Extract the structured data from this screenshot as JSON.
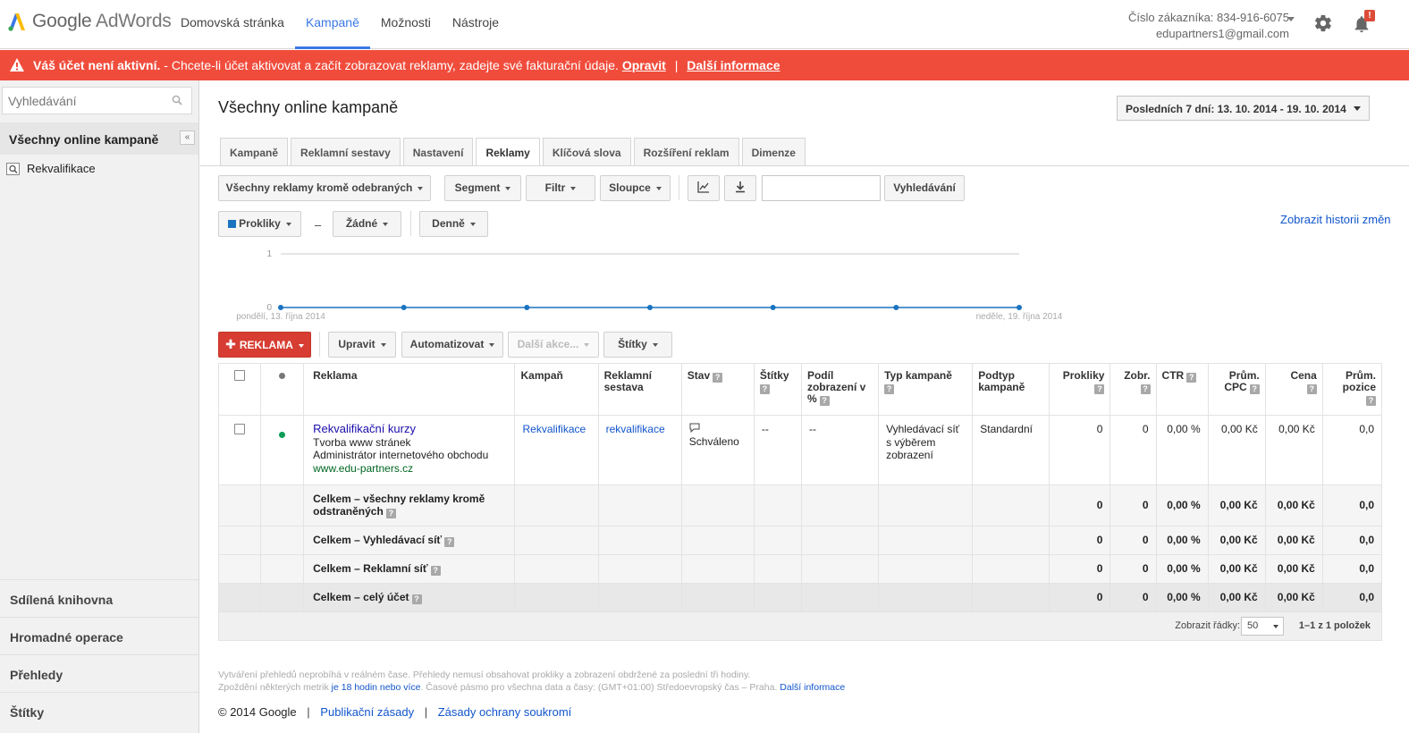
{
  "header": {
    "logo_google": "Google",
    "logo_product": "AdWords",
    "nav": [
      "Domovská stránka",
      "Kampaně",
      "Možnosti",
      "Nástroje"
    ],
    "active_nav": "Kampaně",
    "customer_id_label": "Číslo zákazníka: 834-916-6075",
    "email": "edupartners1@gmail.com",
    "notification_badge": "!"
  },
  "alert": {
    "bold": "Váš účet není aktivní.",
    "text": " - Chcete-li účet aktivovat a začít zobrazovat reklamy, zadejte své fakturační údaje.",
    "link1": "Opravit",
    "sep": "|",
    "link2": "Další informace",
    "color": "#f04c3c"
  },
  "sidebar": {
    "search_placeholder": "Vyhledávání",
    "all_campaigns": "Všechny online kampaně",
    "collapse": "«",
    "campaign": "Rekvalifikace",
    "bottom": [
      "Sdílená knihovna",
      "Hromadné operace",
      "Přehledy",
      "Štítky"
    ]
  },
  "main": {
    "title": "Všechny online kampaně",
    "date_range": "Posledních 7 dní: 13. 10. 2014 - 19. 10. 2014",
    "tabs": [
      "Kampaně",
      "Reklamní sestavy",
      "Nastavení",
      "Reklamy",
      "Klíčová slova",
      "Rozšíření reklam",
      "Dimenze"
    ],
    "active_tab": "Reklamy",
    "toolbar": {
      "filter_all": "Všechny reklamy kromě odebraných",
      "segment": "Segment",
      "filter": "Filtr",
      "columns": "Sloupce",
      "search_button": "Vyhledávání"
    },
    "chart_controls": {
      "metric1": "Prokliky",
      "dash": "–",
      "metric2": "Žádné",
      "period": "Denně",
      "history_link": "Zobrazit historii změn"
    },
    "actions": {
      "add": "REKLAMA",
      "edit": "Upravit",
      "automate": "Automatizovat",
      "more": "Další akce...",
      "labels": "Štítky"
    }
  },
  "chart_data": {
    "type": "line",
    "x": [
      "pondělí, 13. října 2014",
      "",
      "",
      "",
      "",
      "",
      "neděle, 19. října 2014"
    ],
    "series": [
      {
        "values": [
          0,
          0,
          0,
          0,
          0,
          0,
          0
        ]
      }
    ],
    "y_ticks": [
      "1",
      "0"
    ],
    "ylim": [
      0,
      1
    ],
    "grid": true,
    "line_color": "#1a73c0"
  },
  "table": {
    "headers": {
      "ad": "Reklama",
      "campaign": "Kampaň",
      "adgroup_line1": "Reklamní",
      "adgroup_line2": "sestava",
      "status": "Stav",
      "labels": "Štítky",
      "share_line1": "Podíl",
      "share_line2": "zobrazení v",
      "share_line3": "%",
      "camp_type": "Typ kampaně",
      "subtype_line1": "Podtyp",
      "subtype_line2": "kampaně",
      "clicks": "Prokliky",
      "impr": "Zobr.",
      "ctr": "CTR",
      "cpc_line1": "Prům.",
      "cpc_line2": "CPC",
      "cost": "Cena",
      "pos_line1": "Prům.",
      "pos_line2": "pozice",
      "help": "?"
    },
    "row": {
      "ad_title": "Rekvalifikační kurzy",
      "ad_line1": "Tvorba www stránek",
      "ad_line2": "Administrátor internetového obchodu",
      "ad_url": "www.edu-partners.cz",
      "campaign": "Rekvalifikace",
      "adgroup": "rekvalifikace",
      "status": "Schváleno",
      "labels": "--",
      "share": "--",
      "camp_type_1": "Vyhledávací síť",
      "camp_type_2": "s výběrem",
      "camp_type_3": "zobrazení",
      "subtype": "Standardní",
      "clicks": "0",
      "impr": "0",
      "ctr": "0,00 %",
      "cpc": "0,00 Kč",
      "cost": "0,00 Kč",
      "pos": "0,0"
    },
    "totals": [
      {
        "label": "Celkem – všechny reklamy kromě odstraněných",
        "clicks": "0",
        "impr": "0",
        "ctr": "0,00 %",
        "cpc": "0,00 Kč",
        "cost": "0,00 Kč",
        "pos": "0,0"
      },
      {
        "label": "Celkem – Vyhledávací síť",
        "clicks": "0",
        "impr": "0",
        "ctr": "0,00 %",
        "cpc": "0,00 Kč",
        "cost": "0,00 Kč",
        "pos": "0,0"
      },
      {
        "label": "Celkem – Reklamní síť",
        "clicks": "0",
        "impr": "0",
        "ctr": "0,00 %",
        "cpc": "0,00 Kč",
        "cost": "0,00 Kč",
        "pos": "0,0"
      },
      {
        "label": "Celkem – celý účet",
        "clicks": "0",
        "impr": "0",
        "ctr": "0,00 %",
        "cpc": "0,00 Kč",
        "cost": "0,00 Kč",
        "pos": "0,0"
      }
    ],
    "footer": {
      "rows_label": "Zobrazit řádky:",
      "rows_value": "50",
      "range": "1–1 z 1 položek"
    }
  },
  "notes": {
    "line1": "Vytváření přehledů neprobíhá v reálném čase. Přehledy nemusí obsahovat prokliky a zobrazení obdržené za poslední tři hodiny.",
    "line2_a": "Zpoždění některých metrik ",
    "line2_link": "je 18 hodin nebo více",
    "line2_b": ". Časové pásmo pro všechna data a časy: (GMT+01:00) Středoevropský čas – Praha. ",
    "line2_link2": "Další informace"
  },
  "footer": {
    "copyright": "© 2014 Google",
    "sep": "|",
    "link1": "Publikační zásady",
    "link2": "Zásady ochrany soukromí"
  }
}
